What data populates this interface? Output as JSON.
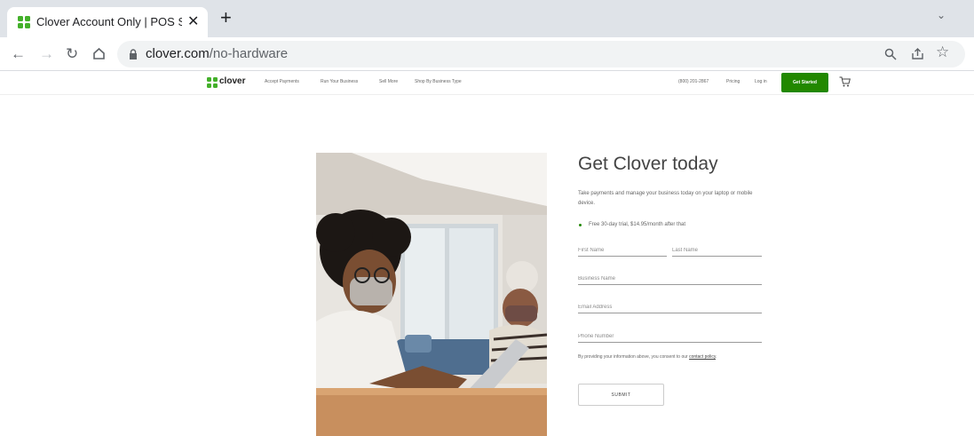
{
  "browser": {
    "tab_title": "Clover Account Only | POS Syste",
    "tab_close": "✕",
    "new_tab": "+",
    "tab_menu": "⌄",
    "url_domain": "clover.com",
    "url_path": "/no-hardware"
  },
  "header": {
    "logo_text": "clover",
    "nav": [
      "Accept Payments",
      "Run Your Business",
      "Sell More",
      "Shop By Business Type"
    ],
    "phone": "(800) 201-2867",
    "pricing": "Pricing",
    "login": "Log in",
    "cta": "Get Started"
  },
  "form": {
    "title": "Get Clover today",
    "description": "Take payments and manage your business today on your laptop or mobile device.",
    "bullet": "Free 30-day trial, $14.95/month after that",
    "first_name_placeholder": "First Name",
    "last_name_placeholder": "Last Name",
    "business_name_placeholder": "Business Name",
    "email_placeholder": "Email Address",
    "phone_placeholder": "Phone Number",
    "consent_text": "By providing your information above, you consent to our ",
    "consent_link": "contact policy",
    "consent_end": ".",
    "submit_label": "SUBMIT"
  },
  "colors": {
    "brand_green": "#228800",
    "tab_strip": "#dfe3e8"
  },
  "icons": [
    "clover-favicon-icon",
    "back-arrow-icon",
    "forward-arrow-icon",
    "reload-icon",
    "home-icon",
    "lock-icon",
    "zoom-icon",
    "share-icon",
    "bookmark-star-icon",
    "more-icon",
    "cart-icon"
  ]
}
